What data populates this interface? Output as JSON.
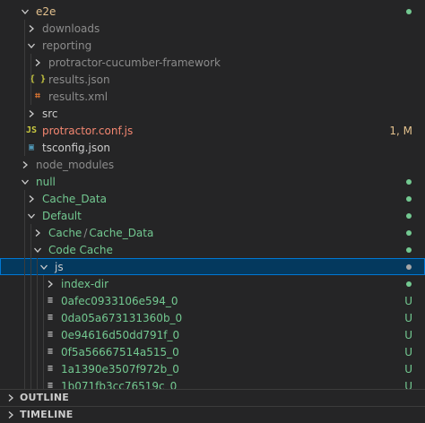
{
  "colors": {
    "folder_default": "#cccccc",
    "untracked_green": "#73c991",
    "modified_orange": "#e2c08d",
    "js_red": "#f48771",
    "json_yellow": "#cbcb41",
    "xml_orange": "#e37933",
    "ts_blue": "#519aba",
    "ignored_gray": "#8c8c8c",
    "selection_bg": "#04395e"
  },
  "tree": [
    {
      "label": "e2e",
      "depth": 0,
      "kind": "folder-open",
      "color": "#e2c08d",
      "dot": true
    },
    {
      "label": "downloads",
      "depth": 1,
      "kind": "folder-closed",
      "color": "#8c8c8c"
    },
    {
      "label": "reporting",
      "depth": 1,
      "kind": "folder-open",
      "color": "#8c8c8c"
    },
    {
      "label": "protractor-cucumber-framework",
      "depth": 2,
      "kind": "folder-closed",
      "color": "#8c8c8c"
    },
    {
      "label": "results.json",
      "depth": 2,
      "kind": "file",
      "icon": "json-icon",
      "glyph": "{ }",
      "icon_color": "#cbcb41",
      "color": "#8c8c8c"
    },
    {
      "label": "results.xml",
      "depth": 2,
      "kind": "file",
      "icon": "rss-xml-icon",
      "glyph": "⌗",
      "icon_color": "#e37933",
      "color": "#8c8c8c"
    },
    {
      "label": "src",
      "depth": 1,
      "kind": "folder-closed",
      "color": "#cccccc"
    },
    {
      "label": "protractor.conf.js",
      "depth": 1,
      "kind": "file",
      "icon": "js-icon",
      "glyph": "JS",
      "icon_color": "#cbcb41",
      "color": "#f48771",
      "decoration": "1, M",
      "decoration_color": "#e2c08d"
    },
    {
      "label": "tsconfig.json",
      "depth": 1,
      "kind": "file",
      "icon": "ts-config-icon",
      "glyph": "▣",
      "icon_color": "#519aba",
      "color": "#cccccc"
    },
    {
      "label": "node_modules",
      "depth": 0,
      "kind": "folder-closed",
      "color": "#8c8c8c"
    },
    {
      "label": "null",
      "depth": 0,
      "kind": "folder-open",
      "color": "#73c991",
      "dot": true
    },
    {
      "label": "Cache_Data",
      "depth": 1,
      "kind": "folder-closed",
      "color": "#73c991",
      "dot": true
    },
    {
      "label": "Default",
      "depth": 1,
      "kind": "folder-open",
      "color": "#73c991",
      "dot": true
    },
    {
      "label": "Cache",
      "label2": "Cache_Data",
      "depth": 2,
      "kind": "folder-closed",
      "color": "#73c991",
      "dot": true
    },
    {
      "label": "Code Cache",
      "depth": 2,
      "kind": "folder-open",
      "color": "#73c991",
      "dot": true
    },
    {
      "label": "js",
      "depth": 3,
      "kind": "folder-open",
      "color": "#cccccc",
      "dot": true,
      "selected": true
    },
    {
      "label": "index-dir",
      "depth": 4,
      "kind": "folder-closed",
      "color": "#73c991",
      "dot": true
    },
    {
      "label": "0afec0933106e594_0",
      "depth": 4,
      "kind": "file",
      "icon": "lines-file-icon",
      "glyph": "≡",
      "icon_color": "#cccccc",
      "color": "#73c991",
      "decoration": "U",
      "decoration_color": "#73c991"
    },
    {
      "label": "0da05a673131360b_0",
      "depth": 4,
      "kind": "file",
      "icon": "lines-file-icon",
      "glyph": "≡",
      "icon_color": "#cccccc",
      "color": "#73c991",
      "decoration": "U",
      "decoration_color": "#73c991"
    },
    {
      "label": "0e94616d50dd791f_0",
      "depth": 4,
      "kind": "file",
      "icon": "lines-file-icon",
      "glyph": "≡",
      "icon_color": "#cccccc",
      "color": "#73c991",
      "decoration": "U",
      "decoration_color": "#73c991"
    },
    {
      "label": "0f5a56667514a515_0",
      "depth": 4,
      "kind": "file",
      "icon": "lines-file-icon",
      "glyph": "≡",
      "icon_color": "#cccccc",
      "color": "#73c991",
      "decoration": "U",
      "decoration_color": "#73c991"
    },
    {
      "label": "1a1390e3507f972b_0",
      "depth": 4,
      "kind": "file",
      "icon": "lines-file-icon",
      "glyph": "≡",
      "icon_color": "#cccccc",
      "color": "#73c991",
      "decoration": "U",
      "decoration_color": "#73c991"
    },
    {
      "label": "1b071fb3cc76519c_0",
      "depth": 4,
      "kind": "file",
      "icon": "lines-file-icon",
      "glyph": "≡",
      "icon_color": "#cccccc",
      "color": "#73c991",
      "decoration": "U",
      "decoration_color": "#73c991"
    }
  ],
  "panels": {
    "outline": "OUTLINE",
    "timeline": "TIMELINE"
  }
}
